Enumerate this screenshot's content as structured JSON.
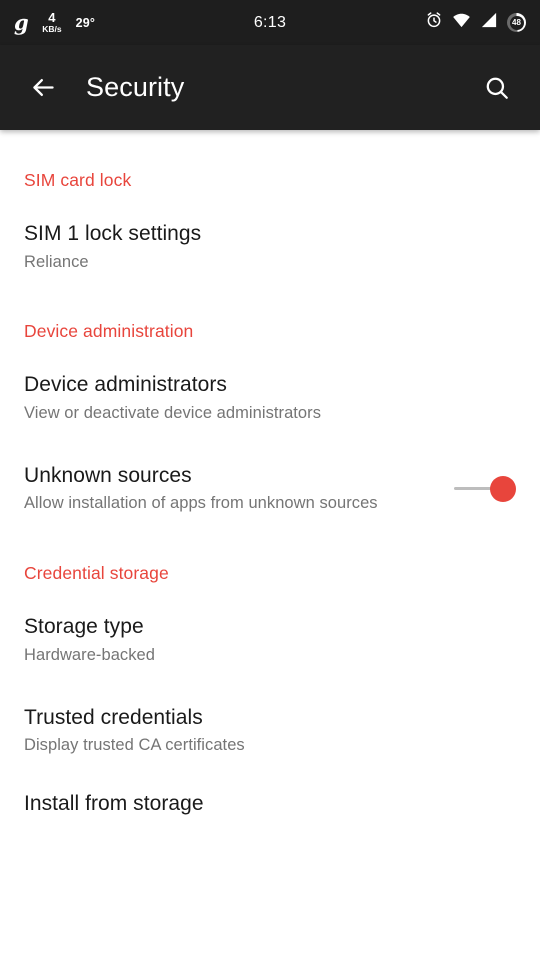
{
  "status_bar": {
    "logo": "g",
    "network_speed_value": "4",
    "network_speed_unit": "KB/s",
    "temperature": "29°",
    "clock": "6:13",
    "alarm_icon": "alarm-clock-icon",
    "wifi_icon": "wifi-icon",
    "signal_icon": "cellular-signal-icon",
    "battery_level": "48"
  },
  "toolbar": {
    "back_icon": "back-arrow-icon",
    "title": "Security",
    "search_icon": "search-icon"
  },
  "colors": {
    "accent": "#e8453c",
    "toolbar_bg": "#212121",
    "status_bg": "#1e1e1e",
    "primary_text": "#1a1a1a",
    "secondary_text": "#757575",
    "page_bg": "#ffffff"
  },
  "sections": [
    {
      "header": "SIM card lock",
      "items": [
        {
          "title": "SIM 1 lock settings",
          "subtitle": "Reliance",
          "control": "none"
        }
      ]
    },
    {
      "header": "Device administration",
      "items": [
        {
          "title": "Device administrators",
          "subtitle": "View or deactivate device administrators",
          "control": "none"
        },
        {
          "title": "Unknown sources",
          "subtitle": "Allow installation of apps from unknown sources",
          "control": "switch",
          "switch_state": "on"
        }
      ]
    },
    {
      "header": "Credential storage",
      "items": [
        {
          "title": "Storage type",
          "subtitle": "Hardware-backed",
          "control": "none"
        },
        {
          "title": "Trusted credentials",
          "subtitle": "Display trusted CA certificates",
          "control": "none"
        },
        {
          "title": "Install from storage",
          "subtitle": "",
          "control": "none"
        }
      ]
    }
  ]
}
